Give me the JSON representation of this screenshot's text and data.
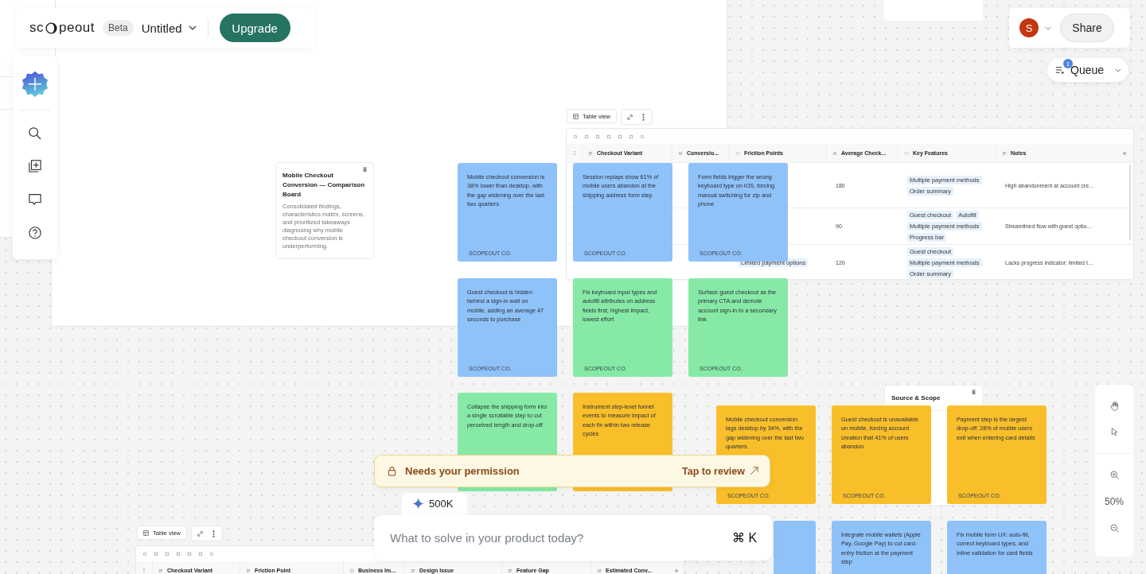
{
  "topbar": {
    "logo_left": "sc",
    "logo_right": "peout",
    "badge": "Beta",
    "doc_title": "Untitled",
    "upgrade": "Upgrade"
  },
  "user": {
    "avatar": "S",
    "share": "Share"
  },
  "queue": {
    "label": "Queue",
    "count": "1"
  },
  "zoom": {
    "reading": "50%"
  },
  "board_card": {
    "title": "Mobile Checkout Conversion — Comparison Board",
    "body": "Consolidated findings, characteristics matrix, screens, and prioritized takeaways diagnosing why mobile checkout conversion is underperforming."
  },
  "source_card": {
    "title": "Source & Scope"
  },
  "table_1": {
    "view_label": "Table view",
    "columns": [
      {
        "name": "Checkout Variant",
        "kind": "text"
      },
      {
        "name": "Conversio...",
        "kind": "number"
      },
      {
        "name": "Friction Points",
        "kind": "multi"
      },
      {
        "name": "Average Check...",
        "kind": "number"
      },
      {
        "name": "Key Features",
        "kind": "multi"
      },
      {
        "name": "Notes",
        "kind": "text"
      }
    ],
    "rows": [
      {
        "friction_tags": [],
        "average": "180",
        "features": [
          "Multiple payment methods",
          "Order summary"
        ],
        "notes": "High abandonment at account cre…"
      },
      {
        "friction_tags": [],
        "average": "90",
        "features": [
          "Guest checkout",
          "Autofill",
          "Multiple payment methods",
          "Progress bar"
        ],
        "notes": "Streamlined flow with guest optio…"
      },
      {
        "friction_tags": [
          "Limited payment options"
        ],
        "average": "120",
        "features": [
          "Guest checkout",
          "Multiple payment methods",
          "Order summary"
        ],
        "notes": "Lacks progress indicator; limited t…"
      }
    ]
  },
  "table_2": {
    "view_label": "Table view",
    "columns": [
      {
        "name": "Checkout Variant",
        "kind": "text"
      },
      {
        "name": "Friction Point",
        "kind": "text"
      },
      {
        "name": "Business Im...",
        "kind": "status"
      },
      {
        "name": "Design Issue",
        "kind": "text"
      },
      {
        "name": "Feature Gap",
        "kind": "text"
      },
      {
        "name": "Estimated Conv...",
        "kind": "number"
      }
    ]
  },
  "notes": [
    {
      "color": "#90c2fa",
      "text": "Mobile checkout conversion is 38% lower than desktop, with the gap widening over the last two quarters",
      "footer": "SCOPEOUT CO."
    },
    {
      "color": "#90c2fa",
      "text": "Session replays show 61% of mobile users abandon at the shipping address form step",
      "footer": "SCOPEOUT CO."
    },
    {
      "color": "#90c2fa",
      "text": "Form fields trigger the wrong keyboard type on iOS, forcing manual switching for zip and phone",
      "footer": "SCOPEOUT CO."
    },
    {
      "color": "#90c2fa",
      "text": "Guest checkout is hidden behind a sign-in wall on mobile, adding an average 47 seconds to purchase",
      "footer": "SCOPEOUT CO."
    },
    {
      "color": "#86eaa6",
      "text": "Fix keyboard input types and autofill attributes on address fields first; highest impact, lowest effort",
      "footer": "SCOPEOUT CO."
    },
    {
      "color": "#86eaa6",
      "text": "Surface guest checkout as the primary CTA and demote account sign-in to a secondary link",
      "footer": "SCOPEOUT CO."
    },
    {
      "color": "#86eaa6",
      "text": "Collapse the shipping form into a single scrollable step to cut perceived length and drop-off"
    },
    {
      "color": "#f9bf2a",
      "text": "Instrument step-level funnel events to measure impact of each fix within two release cycles"
    },
    {
      "color": "#f9bf2a",
      "text": "Mobile checkout conversion lags desktop by 34%, with the gap widening over the last two quarters",
      "footer": "SCOPEOUT CO."
    },
    {
      "color": "#f9bf2a",
      "text": "Guest checkout is unavailable on mobile, forcing account creation that 41% of users abandon",
      "footer": "SCOPEOUT CO."
    },
    {
      "color": "#f9bf2a",
      "text": "Payment step is the largest drop-off: 28% of mobile users exit when entering card details",
      "footer": "SCOPEOUT CO."
    },
    {
      "color": "#90c2fa"
    },
    {
      "color": "#90c2fa",
      "text": "Integrate mobile wallets (Apple Pay, Google Pay) to cut card-entry friction at the payment step"
    },
    {
      "color": "#90c2fa",
      "text": "Fix mobile form UX: auto-fill, correct keyboard types, and inline validation for card fields"
    }
  ],
  "banner": {
    "text": "Needs your permission",
    "action": "Tap to review"
  },
  "prompt": {
    "tokens": "500K",
    "placeholder": "What to solve in your product today?",
    "shortcut": "⌘ K"
  }
}
